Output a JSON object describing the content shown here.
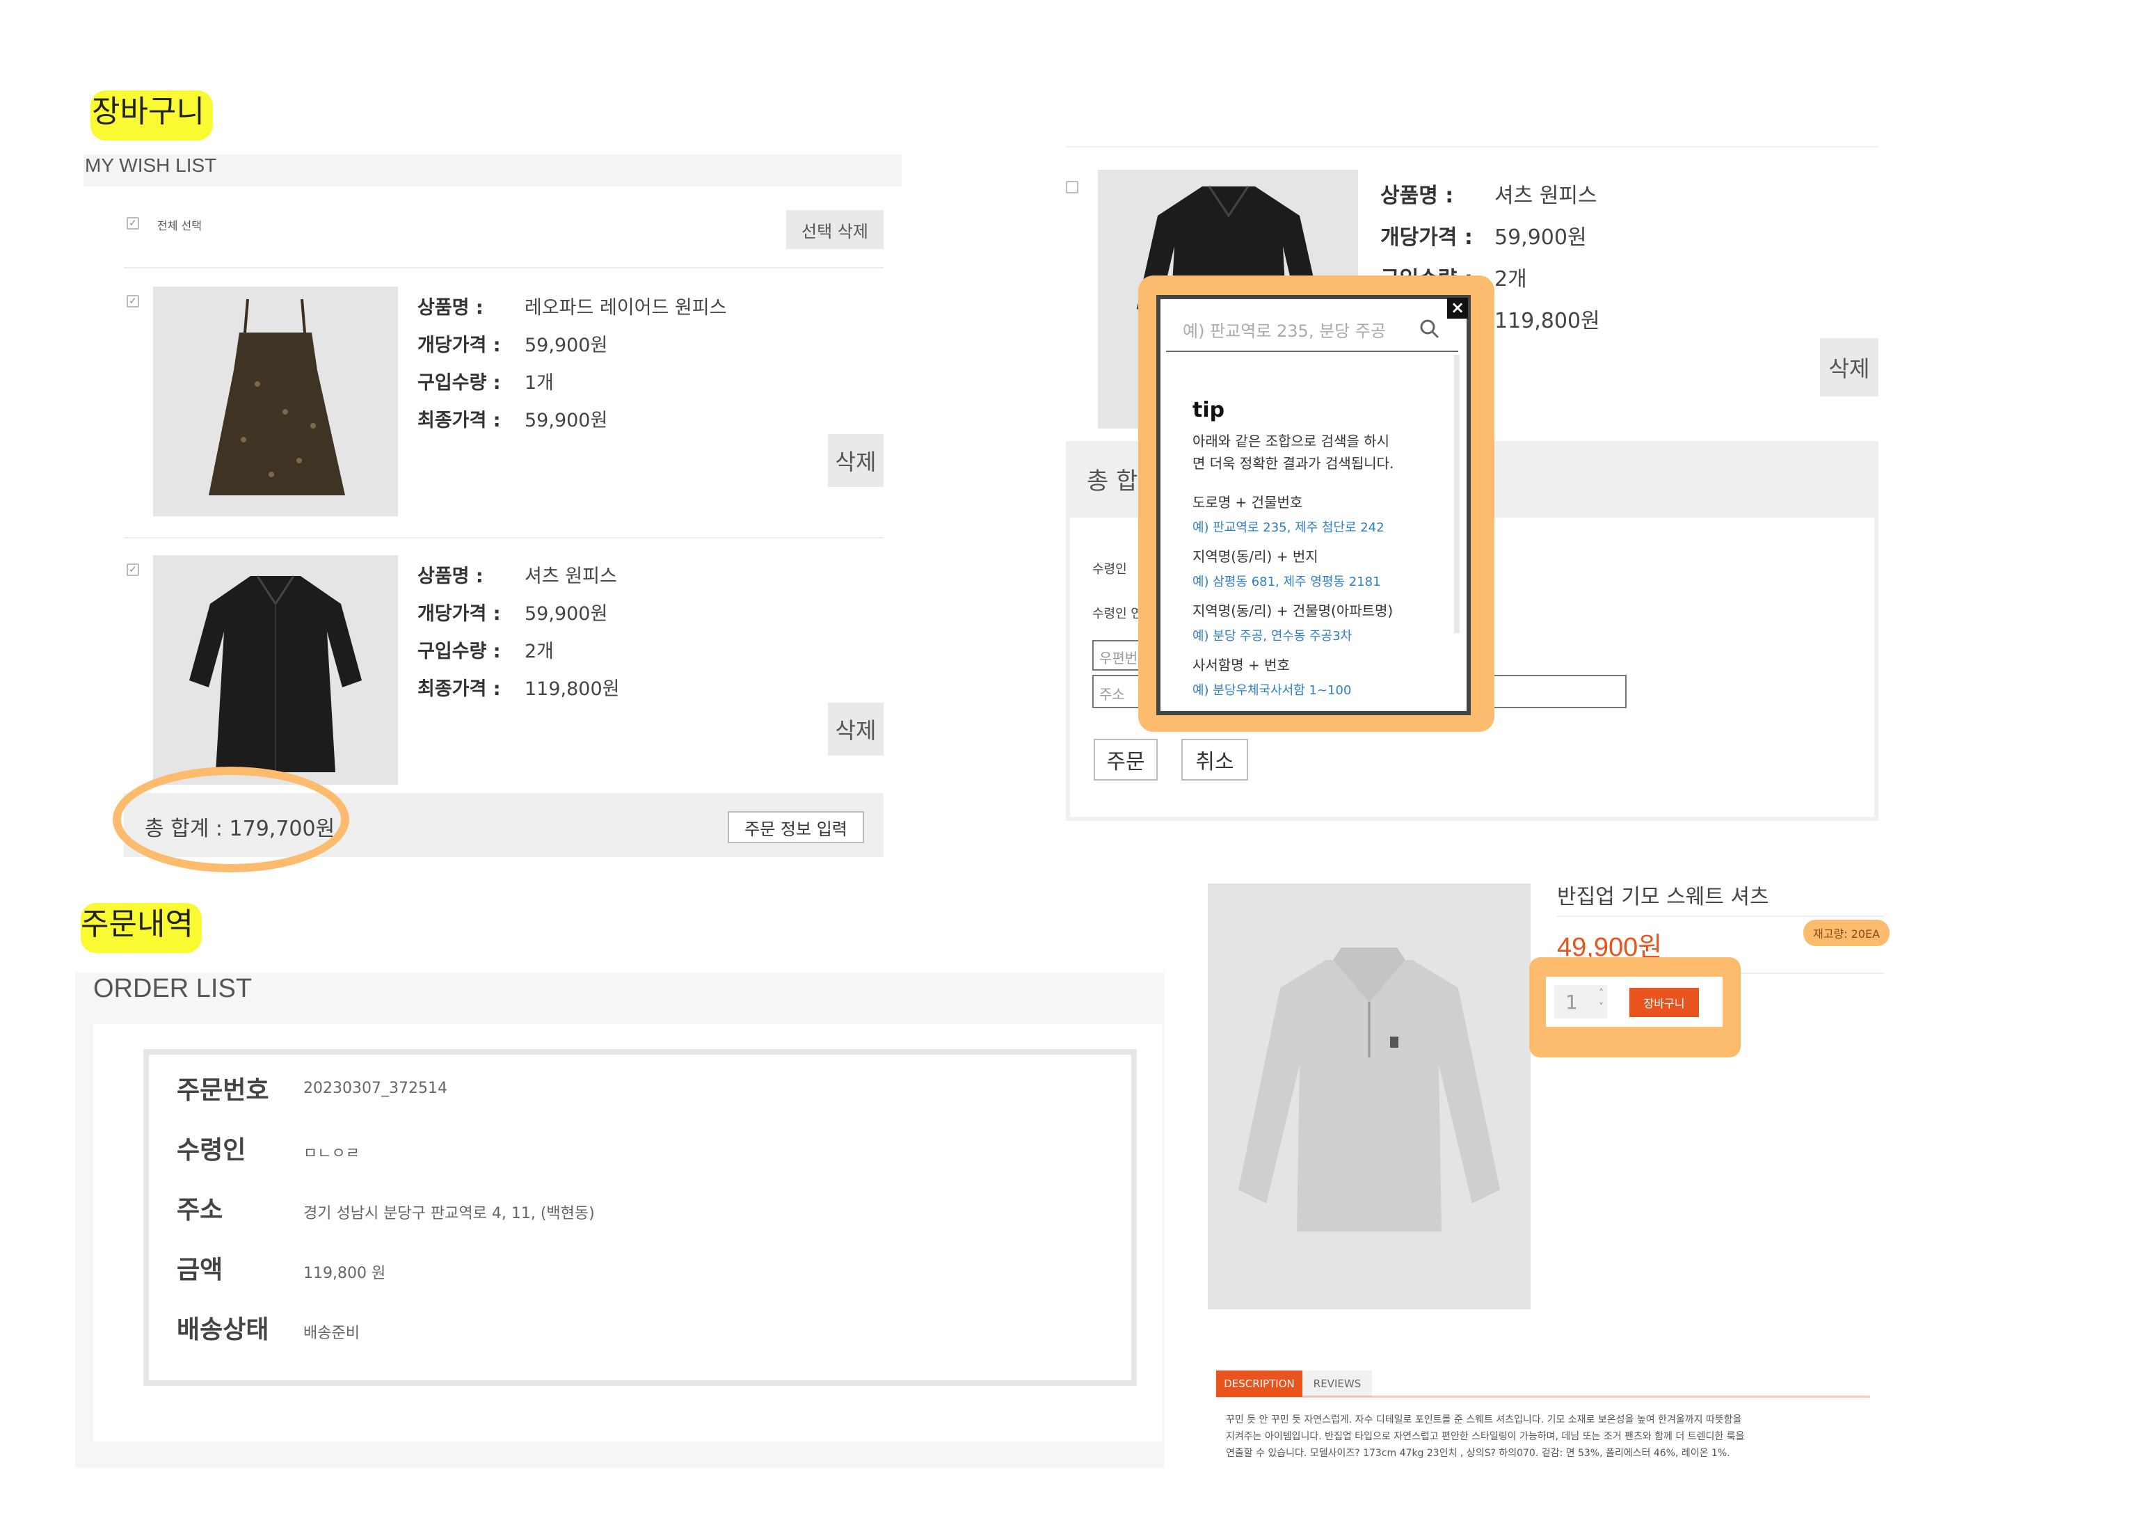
{
  "cart": {
    "heading": "장바구니",
    "subheading": "MY WISH LIST",
    "select_all": "전체 선택",
    "delete_selected": "선택 삭제",
    "items": [
      {
        "name_label": "상품명 :",
        "name": "레오파드 레이어드 원피스",
        "price_label": "개당가격 :",
        "price": "59,900원",
        "qty_label": "구입수량 :",
        "qty": "1개",
        "total_label": "최종가격 :",
        "total": "59,900원",
        "delete": "삭제"
      },
      {
        "name_label": "상품명 :",
        "name": "셔츠 원피스",
        "price_label": "개당가격 :",
        "price": "59,900원",
        "qty_label": "구입수량 :",
        "qty": "2개",
        "total_label": "최종가격 :",
        "total": "119,800원",
        "delete": "삭제"
      }
    ],
    "sum_text": "총 합계 : 179,700원",
    "order_info_button": "주문 정보 입력"
  },
  "order_form": {
    "item": {
      "name_label": "상품명 :",
      "name": "셔츠 원피스",
      "price_label": "개당가격 :",
      "price": "59,900원",
      "qty_label": "구입수량 :",
      "qty": "2개",
      "total": "119,800원",
      "delete": "삭제"
    },
    "sum_label": "총 합계",
    "receiver_label": "수령인",
    "receiver_contact_label": "수령인 연락",
    "zipcode_placeholder": "우편번호",
    "address_placeholder": "주소",
    "order_button": "주문",
    "cancel_button": "취소"
  },
  "address_popup": {
    "search_placeholder": "예) 판교역로 235, 분당 주공",
    "close": "×",
    "tip_title": "tip",
    "tip_desc_1": "아래와 같은 조합으로 검색을 하시",
    "tip_desc_2": "면 더욱 정확한 결과가 검색됩니다.",
    "rows": [
      {
        "label": "도로명 + 건물번호",
        "example": "예) 판교역로 235,  제주 첨단로 242"
      },
      {
        "label": "지역명(동/리) + 번지",
        "example": "예) 삼평동 681,  제주 영평동 2181"
      },
      {
        "label": "지역명(동/리) + 건물명(아파트명)",
        "example": "예) 분당 주공,  연수동 주공3차"
      },
      {
        "label": "사서함명 + 번호",
        "example": "예) 분당우체국사서함 1~100"
      }
    ]
  },
  "orders": {
    "heading": "주문내역",
    "subheading": "ORDER LIST",
    "rows": [
      {
        "label": "주문번호",
        "value": "20230307_372514"
      },
      {
        "label": "수령인",
        "value": "ㅁㄴㅇㄹ"
      },
      {
        "label": "주소",
        "value": "경기 성남시 분당구 판교역로 4, 11, (백현동)"
      },
      {
        "label": "금액",
        "value": "119,800 원"
      },
      {
        "label": "배송상태",
        "value": "배송준비"
      }
    ]
  },
  "product": {
    "title": "반집업 기모 스웨트 셔츠",
    "price": "49,900원",
    "stock": "재고량: 20EA",
    "qty": "1",
    "cart_button": "장바구니",
    "tabs": [
      "DESCRIPTION",
      "REVIEWS"
    ],
    "description_1": "꾸민 듯 안 꾸민 듯 자연스럽게. 자수 디테일로 포인트를 준 스웨트 셔츠입니다. 기모 소재로 보온성을 높여 한겨울까지 따뜻함을",
    "description_2": "지켜주는 아이템입니다. 반집업 타입으로 자연스럽고 편안한 스타일링이 가능하며, 데님 또는 조거 팬츠와 함께 더 트렌디한 룩을",
    "description_3": "연출할 수 있습니다. 모델사이즈? 173cm 47kg 23인치 , 상의S? 하의070. 겉감: 면 53%, 폴리에스터 46%, 레이온 1%."
  },
  "colors": {
    "accent": "#e9531d",
    "highlight": "#fafa32",
    "annotation": "#fdbb6e",
    "link": "#2e7fc8"
  }
}
